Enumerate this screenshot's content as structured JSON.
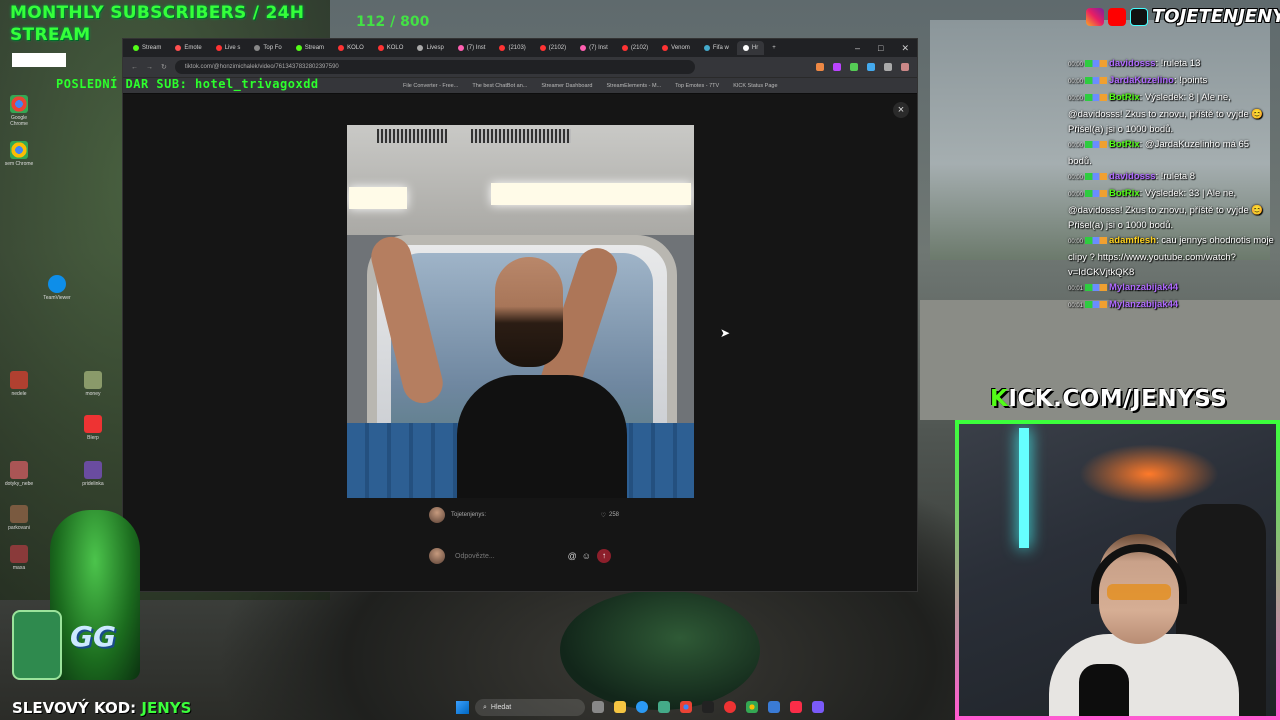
{
  "overlay": {
    "subs_line1": "MONTHLY SUBSCRIBERS / 24H",
    "subs_line2": "STREAM",
    "sub_counter": "112 / 800",
    "last_line": "POSLEDNÍ  DAR  SUB: hotel_trivagoxdd"
  },
  "browser": {
    "tabs": [
      {
        "label": "Stream",
        "color": "#53fc18"
      },
      {
        "label": "Emote",
        "color": "#ff5050"
      },
      {
        "label": "Live s",
        "color": "#ff3333"
      },
      {
        "label": "Top Fo",
        "color": "#888"
      },
      {
        "label": "Stream",
        "color": "#53fc18"
      },
      {
        "label": "KOLO",
        "color": "#ff3333"
      },
      {
        "label": "KOLO",
        "color": "#ff3333"
      },
      {
        "label": "Livesp",
        "color": "#aaa"
      },
      {
        "label": "(7) Inst",
        "color": "#ff5fb0"
      },
      {
        "label": "(2103)",
        "color": "#ff3333"
      },
      {
        "label": "(2102)",
        "color": "#ff3333"
      },
      {
        "label": "(7) Inst",
        "color": "#ff5fb0"
      },
      {
        "label": "(2102)",
        "color": "#ff3333"
      },
      {
        "label": "Venom",
        "color": "#ff3333"
      },
      {
        "label": "Fifa w",
        "color": "#4ac"
      },
      {
        "label": "Hr",
        "color": "#fff"
      }
    ],
    "url": "tiktok.com/@honzimichalek/video/7613437832802397590",
    "bookmarks": [
      "File Converter - Free...",
      "The best ChatBot an...",
      "Streamer Dashboard",
      "StreamElements - M...",
      "Top Emotes - 7TV",
      "KICK Status Page"
    ],
    "close_icon": "×"
  },
  "video_post": {
    "author": "Tojetenjenys:",
    "likes": "258",
    "reply_placeholder": "Odpovězte...",
    "mention_icon": "@",
    "emoji_icon": "☺",
    "send_icon": "↑"
  },
  "socials": {
    "name": "TOJETENJENYS"
  },
  "chat": [
    {
      "time": "00:00",
      "user": "davidosss",
      "color": "#b06bff",
      "text": ": !ruleta 13"
    },
    {
      "time": "00:00",
      "user": "JardaKuzelino",
      "color": "#b06bff",
      "text": ": !points"
    },
    {
      "time": "00:00",
      "user": "BotRix",
      "color": "#53fc18",
      "text": ": Výsledek: 8 | Ale ne, @davidosss! Zkus to znovu, příště to vyjde 😊 Přišel(a) jsi o 1000 bodů."
    },
    {
      "time": "00:00",
      "user": "BotRix",
      "color": "#53fc18",
      "text": ": @JardaKuzelinho má 65 bodů."
    },
    {
      "time": "00:00",
      "user": "davidosss",
      "color": "#b06bff",
      "text": ": !ruleta 8"
    },
    {
      "time": "00:00",
      "user": "BotRix",
      "color": "#53fc18",
      "text": ": Výsledek: 33 | Ale ne, @davidosss! Zkus to znovu, příště to vyjde 😊 Přišel(a) jsi o 1000 bodů."
    },
    {
      "time": "00:00",
      "user": "adamflesh",
      "color": "#ffd21f",
      "text": ": cau jennys ohodnotis moje clipy ? https://www.youtube.com/watch?v=IdCKVjtkQK8"
    },
    {
      "time": "00:01",
      "user": "Mylanzabijak44",
      "color": "#b06bff",
      "text": ""
    },
    {
      "time": "00:01",
      "user": "Mylanzabijak44",
      "color": "#b06bff",
      "text": ""
    }
  ],
  "kick_banner": {
    "k": "K",
    "rest": "ICK.COM/JENYSS"
  },
  "promo": {
    "label": "SLEVOVÝ KOD:",
    "code": "JENYS"
  },
  "booster_logo": "GG",
  "taskbar": {
    "search_label": "Hledat",
    "search_icon": "⌕"
  },
  "desktop_icons": [
    "Google Chrome",
    "sem Chrome",
    "TeamViewer",
    "money",
    "nedele",
    "Blerp",
    "dotyky_nebe",
    "pridelinka",
    "parkovani",
    "maxa"
  ]
}
